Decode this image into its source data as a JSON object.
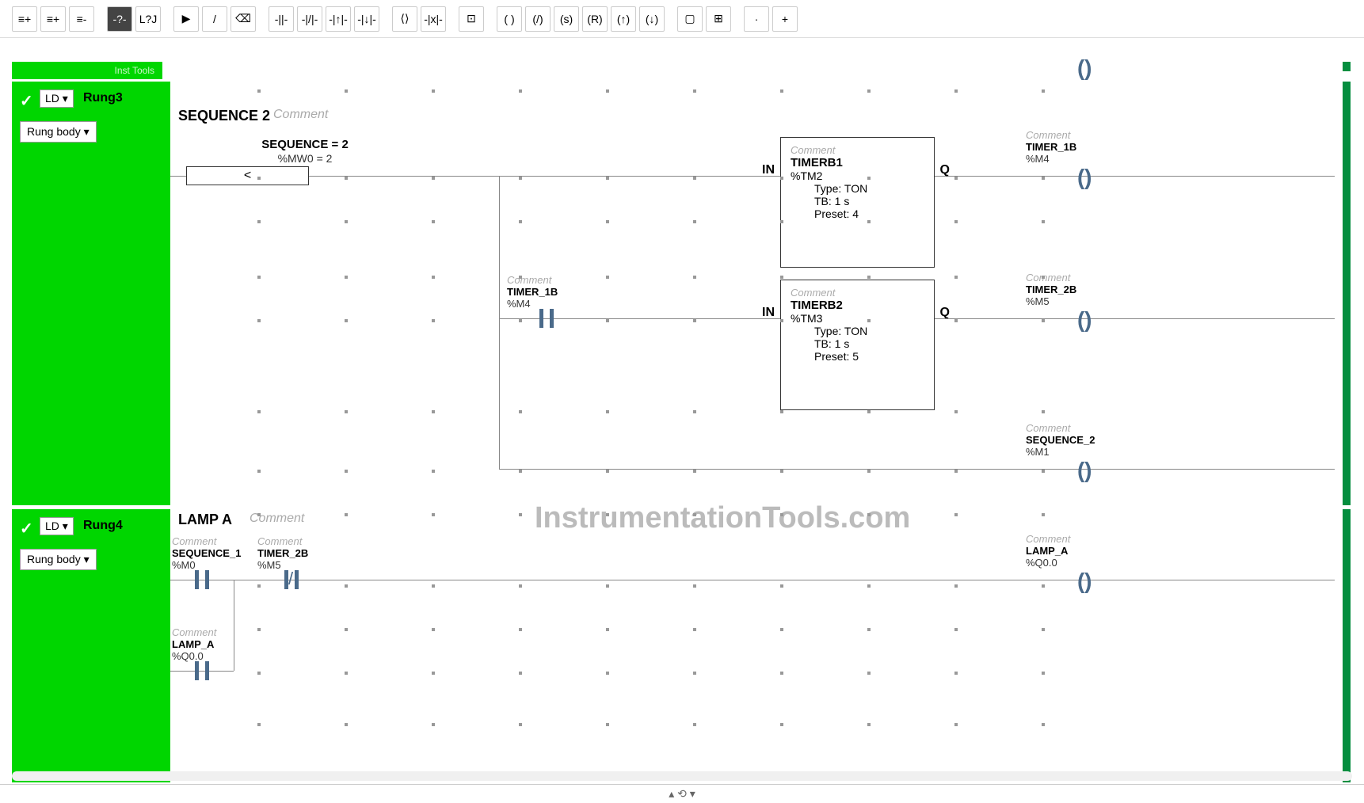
{
  "toolbar": {
    "buttons": [
      "≡+",
      "≡+",
      "≡-",
      "-?-",
      "L?J",
      "▶",
      "/",
      "⌫",
      "-||-",
      "-|/|-",
      "-|↑|-",
      "-|↓|-",
      "⟨⟩",
      "-|x|-",
      "⊡",
      "( )",
      "(/)",
      "(s)",
      "(R)",
      "(↑)",
      "(↓)",
      "▢",
      "⊞",
      "·",
      "+"
    ]
  },
  "sidebar": {
    "rung3": {
      "check": "✓",
      "ld": "LD ▾",
      "name": "Rung3",
      "body": "Rung body ▾",
      "tools": "Inst Tools"
    },
    "rung4": {
      "check": "✓",
      "ld": "LD ▾",
      "name": "Rung4",
      "body": "Rung body ▾"
    }
  },
  "rung3": {
    "title": "SEQUENCE 2",
    "comment": "Comment",
    "compare": {
      "label": "SEQUENCE = 2",
      "addr": "%MW0 = 2",
      "op": "<"
    },
    "contact_timer1b": {
      "comment": "Comment",
      "name": "TIMER_1B",
      "addr": "%M4"
    },
    "block_timerb1": {
      "comment": "Comment",
      "name": "TIMERB1",
      "addr": "%TM2",
      "type_label": "Type:",
      "type_val": "TON",
      "tb_label": "TB:",
      "tb_val": "1 s",
      "preset_label": "Preset:",
      "preset_val": "4",
      "in": "IN",
      "q": "Q"
    },
    "block_timerb2": {
      "comment": "Comment",
      "name": "TIMERB2",
      "addr": "%TM3",
      "type_label": "Type:",
      "type_val": "TON",
      "tb_label": "TB:",
      "tb_val": "1 s",
      "preset_label": "Preset:",
      "preset_val": "5",
      "in": "IN",
      "q": "Q"
    },
    "coil_timer1b": {
      "comment": "Comment",
      "name": "TIMER_1B",
      "addr": "%M4"
    },
    "coil_timer2b": {
      "comment": "Comment",
      "name": "TIMER_2B",
      "addr": "%M5"
    },
    "coil_seq2": {
      "comment": "Comment",
      "name": "SEQUENCE_2",
      "addr": "%M1"
    }
  },
  "rung4": {
    "title": "LAMP A",
    "comment": "Comment",
    "contact_seq1": {
      "comment": "Comment",
      "name": "SEQUENCE_1",
      "addr": "%M0"
    },
    "contact_timer2b": {
      "comment": "Comment",
      "name": "TIMER_2B",
      "addr": "%M5"
    },
    "contact_lampa": {
      "comment": "Comment",
      "name": "LAMP_A",
      "addr": "%Q0.0"
    },
    "coil_lampa": {
      "comment": "Comment",
      "name": "LAMP_A",
      "addr": "%Q0.0"
    }
  },
  "watermark": "InstrumentationTools.com",
  "bottom": {
    "collapse": "▴ ⟲ ▾"
  },
  "coil_symbol": "( )"
}
